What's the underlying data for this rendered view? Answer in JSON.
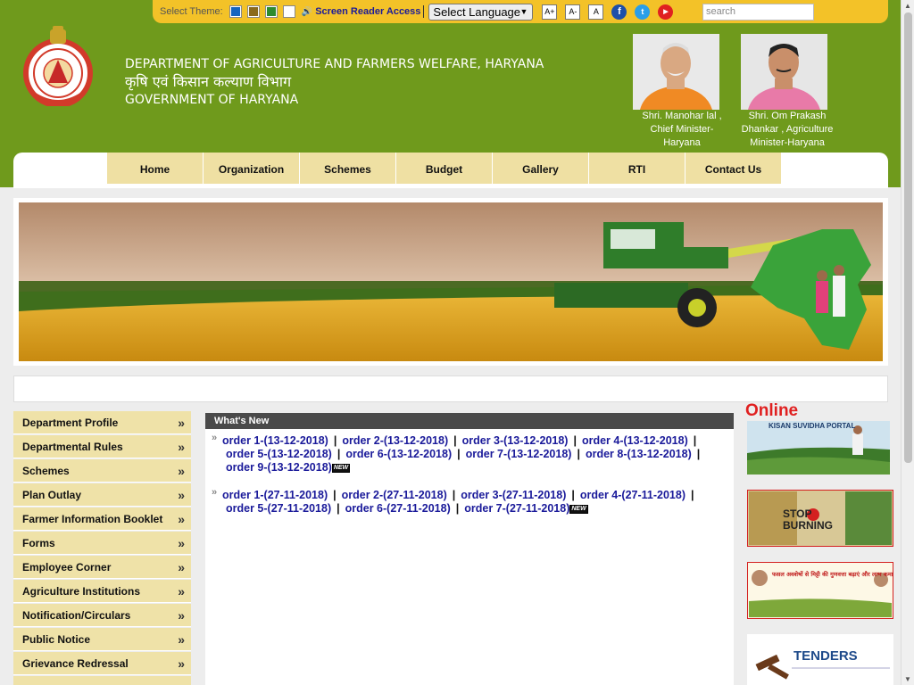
{
  "topbar": {
    "theme_label": "Select Theme:",
    "theme_colors": [
      "#1565c0",
      "#8a6a1c",
      "#2e8b2e",
      "#ffffff"
    ],
    "screen_reader": "Screen Reader Access",
    "language": "Select Language",
    "font_larger": "A+",
    "font_smaller": "A-",
    "font_normal": "A",
    "search_placeholder": "search"
  },
  "header": {
    "title_en": "DEPARTMENT OF AGRICULTURE AND FARMERS WELFARE, HARYANA",
    "title_hi": "कृषि एवं किसान कल्याण विभाग",
    "gov": "GOVERNMENT OF HARYANA",
    "cm_caption": "Shri. Manohar lal , Chief Minister- Haryana",
    "minister_caption": "Shri. Om Prakash Dhankar , Agriculture Minister-Haryana"
  },
  "nav": [
    "Home",
    "Organization",
    "Schemes",
    "Budget",
    "Gallery",
    "RTI",
    "Contact Us"
  ],
  "sidebar": [
    "Department Profile",
    "Departmental Rules",
    "Schemes",
    "Plan Outlay",
    "Farmer Information Booklet",
    "Forms",
    "Employee Corner",
    "Agriculture Institutions",
    "Notification/Circulars",
    "Public Notice",
    "Grievance Redressal"
  ],
  "whats_new": {
    "title": "What's New",
    "group1": [
      "order 1-(13-12-2018)",
      "order 2-(13-12-2018)",
      "order 3-(13-12-2018)",
      "order 4-(13-12-2018)",
      "order 5-(13-12-2018)",
      "order 6-(13-12-2018)",
      "order 7-(13-12-2018)",
      "order 8-(13-12-2018)",
      "order 9-(13-12-2018)"
    ],
    "group2": [
      "order 1-(27-11-2018)",
      "order 2-(27-11-2018)",
      "order 3-(27-11-2018)",
      "order 4-(27-11-2018)",
      "order 5-(27-11-2018)",
      "order 6-(27-11-2018)",
      "order 7-(27-11-2018)"
    ],
    "new_badge": "NEW"
  },
  "right": {
    "online": "Online",
    "kisan": "KISAN SUVIDHA PORTAL",
    "stop": "STOP",
    "burning": "BURNING",
    "fasal_hi": "फसल अवशेषों से मिट्टी की गुणवत्ता बढ़ाएं और लाभ कमाएं",
    "tenders": "TENDERS"
  }
}
